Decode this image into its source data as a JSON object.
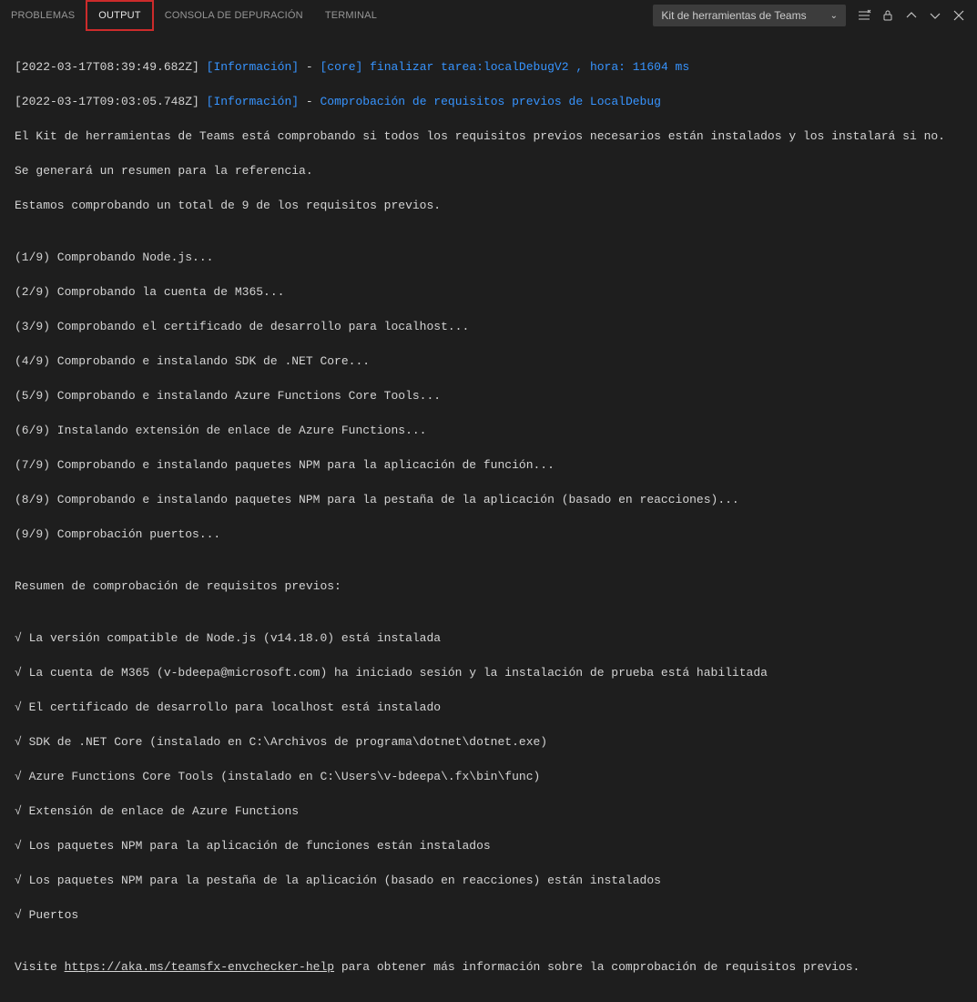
{
  "tabs": {
    "problems": "PROBLEMAS",
    "output": "OUTPUT",
    "debugConsole": "CONSOLA DE DEPURACIÓN",
    "terminal": "TERMINAL"
  },
  "dropdown": {
    "selected": "Kit de herramientas de Teams"
  },
  "lines": {
    "l1_ts": "[2022-03-17T08:39:49.682Z]",
    "l1_info": "[Información]",
    "l1_dash": " - ",
    "l1_core": "[core]",
    "l1_msg": " finalizar tarea:localDebugV2 , hora: 11604 ms",
    "l2_ts": "[2022-03-17T09:03:05.748Z]",
    "l2_info": "[Información]",
    "l2_dash": " - ",
    "l2_msg": "Comprobación de requisitos previos de LocalDebug",
    "l3": "El Kit de herramientas de Teams está comprobando si todos los requisitos previos necesarios están instalados y los instalará si no.",
    "l4": "Se generará un resumen para la referencia.",
    "l5": "Estamos comprobando un total de 9 de los requisitos previos.",
    "blank": "",
    "c1": "(1/9) Comprobando Node.js...",
    "c2": "(2/9) Comprobando la cuenta de M365...",
    "c3": "(3/9) Comprobando el certificado de desarrollo para localhost...",
    "c4": "(4/9) Comprobando e instalando SDK de .NET Core...",
    "c5": "(5/9) Comprobando e instalando Azure Functions Core Tools...",
    "c6": "(6/9) Instalando extensión de enlace de Azure Functions...",
    "c7": "(7/9) Comprobando e instalando paquetes NPM para la aplicación de función...",
    "c8": "(8/9) Comprobando e instalando paquetes NPM para la pestaña de la aplicación (basado en reacciones)...",
    "c9": "(9/9) Comprobación puertos...",
    "summaryTitle": "Resumen de comprobación de requisitos previos:",
    "s1": "√ La versión compatible de Node.js (v14.18.0) está instalada",
    "s2": "√ La cuenta de M365 (v-bdeepa@microsoft.com) ha iniciado sesión y la instalación de prueba está habilitada",
    "s3": "√ El certificado de desarrollo para localhost está instalado",
    "s4": "√ SDK de .NET Core (instalado en C:\\Archivos de programa\\dotnet\\dotnet.exe)",
    "s5": "√ Azure Functions Core Tools (instalado en C:\\Users\\v-bdeepa\\.fx\\bin\\func)",
    "s6": "√ Extensión de enlace de Azure Functions",
    "s7": "√ Los paquetes NPM para la aplicación de funciones están instalados",
    "s8": "√ Los paquetes NPM para la pestaña de la aplicación (basado en reacciones) están instalados",
    "s9": "√ Puertos",
    "visitPre": "Visite ",
    "visitLink": "https://aka.ms/teamsfx-envchecker-help",
    "visitPost": " para obtener más información sobre la comprobación de requisitos previos."
  }
}
